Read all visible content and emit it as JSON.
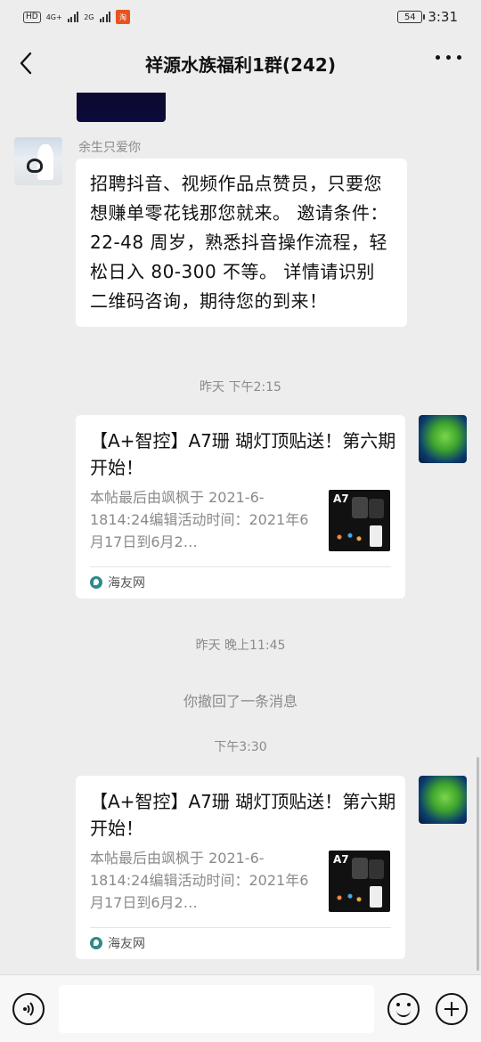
{
  "status_bar": {
    "left_chip": "HD",
    "network_1": "4G+",
    "network_2": "2G",
    "app_badge": "淘",
    "battery": "54",
    "time": "3:31"
  },
  "header": {
    "title": "祥源水族福利1群(242)"
  },
  "messages": {
    "m1": {
      "sender": "余生只爱你",
      "text": "招聘抖音、视频作品点赞员，只要您想赚单零花钱那您就来。 邀请条件：22-48 周岁，熟悉抖音操作流程，轻松日入 80-300 不等。 详情请识别二维码咨询，期待您的到来！"
    },
    "ts1": "昨天 下午2:15",
    "card1": {
      "title": "【A+智控】A7珊 瑚灯顶贴送！第六期开始！",
      "desc": "本帖最后由飒枫于 2021-6-1814:24编辑活动时间：2021年6月17日到6月2…",
      "thumb_label": "A7",
      "source": "海友网"
    },
    "ts2": "昨天 晚上11:45",
    "recall": "你撤回了一条消息",
    "ts3": "下午3:30",
    "card2": {
      "title": "【A+智控】A7珊 瑚灯顶贴送！第六期开始！",
      "desc": "本帖最后由飒枫于 2021-6-1814:24编辑活动时间：2021年6月17日到6月2…",
      "thumb_label": "A7",
      "source": "海友网"
    }
  },
  "input_bar": {
    "value": ""
  },
  "icons": {
    "back": "chevron-left-icon",
    "more": "more-dots-icon",
    "voice": "voice-icon",
    "emoji": "emoji-icon",
    "plus": "plus-icon"
  }
}
